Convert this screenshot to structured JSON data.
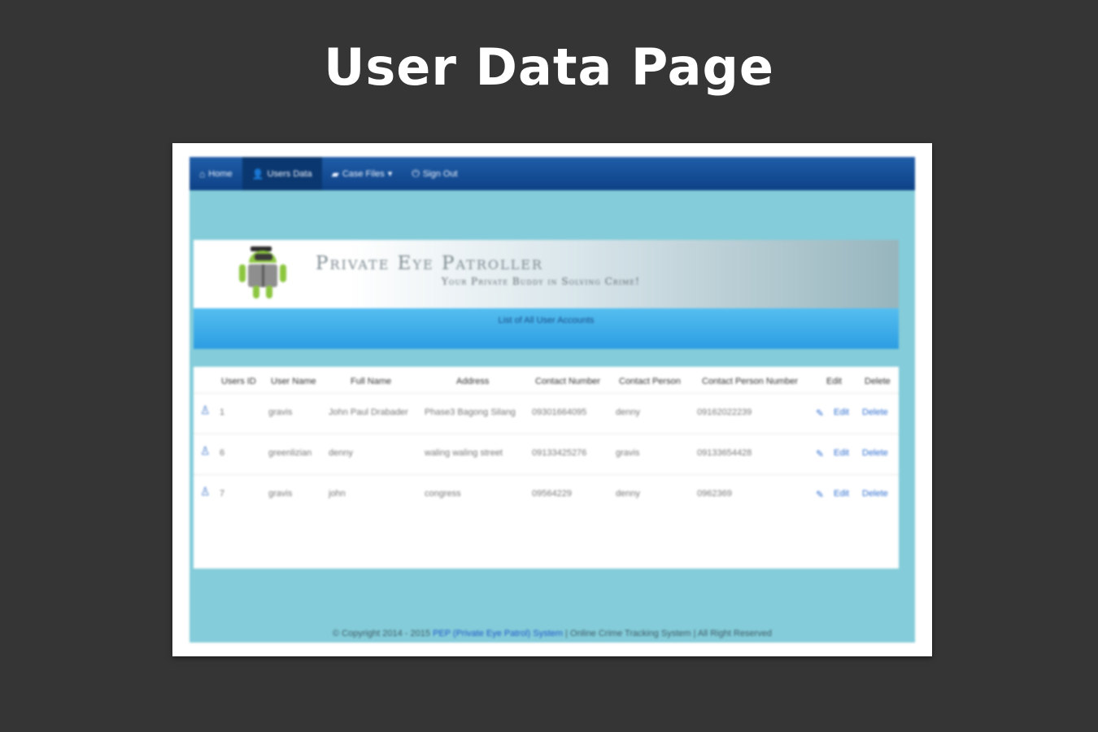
{
  "page": {
    "title": "User Data Page"
  },
  "nav": {
    "items": [
      {
        "label": "Home",
        "icon": "home-icon"
      },
      {
        "label": "Users Data",
        "icon": "user-icon"
      },
      {
        "label": "Case Files",
        "icon": "folder-icon"
      },
      {
        "label": "Sign Out",
        "icon": "power-icon"
      }
    ]
  },
  "banner": {
    "title": "Private Eye Patroller",
    "subtitle": "Your Private Buddy in Solving Crime!"
  },
  "heading": {
    "text": "List of All User Accounts"
  },
  "table": {
    "headers": [
      "Users ID",
      "User Name",
      "Full Name",
      "Address",
      "Contact Number",
      "Contact Person",
      "Contact Person Number",
      "Edit",
      "Delete"
    ],
    "rows": [
      {
        "id": "1",
        "username": "gravis",
        "fullname": "John Paul Drabader",
        "address": "Phase3 Bagong Silang",
        "contact": "09301664095",
        "contact_person": "denny",
        "contact_person_number": "09162022239",
        "edit": "Edit",
        "delete": "Delete"
      },
      {
        "id": "6",
        "username": "greenlizian",
        "fullname": "denny",
        "address": "waling waling street",
        "contact": "09133425276",
        "contact_person": "gravis",
        "contact_person_number": "09133654428",
        "edit": "Edit",
        "delete": "Delete"
      },
      {
        "id": "7",
        "username": "gravis",
        "fullname": "john",
        "address": "congress",
        "contact": "09564229",
        "contact_person": "denny",
        "contact_person_number": "0962369",
        "edit": "Edit",
        "delete": "Delete"
      }
    ]
  },
  "footer": {
    "prefix": "© Copyright 2014 - 2015",
    "link": "PEP (Private Eye Patrol) System",
    "suffix": "| Online Crime Tracking System | All Right Reserved"
  },
  "colors": {
    "background": "#353535",
    "navbar": "#0d4186",
    "content": "#84ccd9",
    "heading_bar": "#2c9de2"
  }
}
